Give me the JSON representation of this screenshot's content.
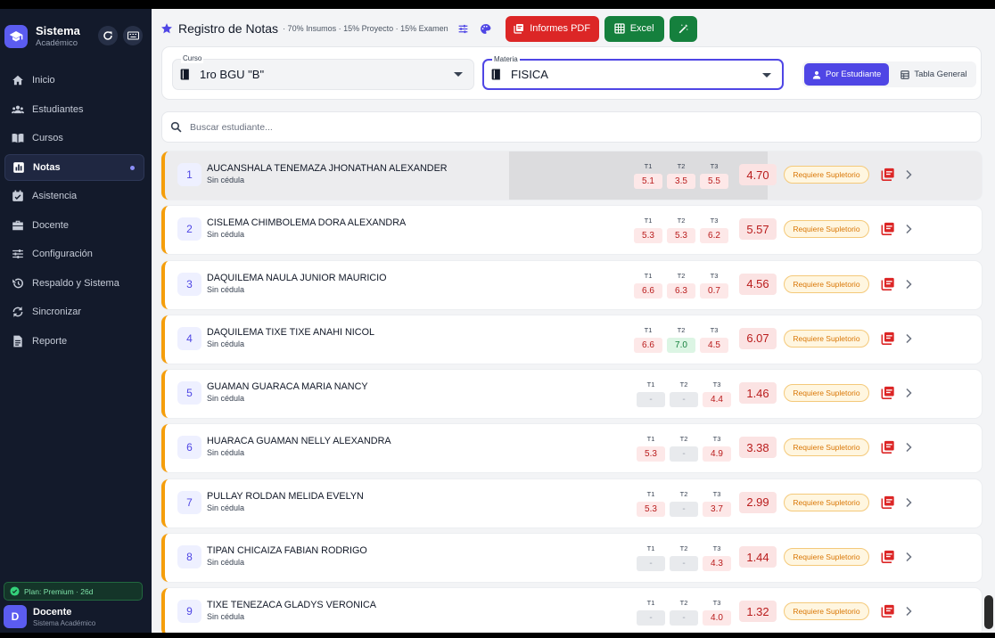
{
  "sidebar": {
    "title": "Sistema",
    "subtitle": "Académico",
    "items": [
      {
        "label": "Inicio",
        "icon": "home-icon"
      },
      {
        "label": "Estudiantes",
        "icon": "users-icon"
      },
      {
        "label": "Cursos",
        "icon": "book-open-icon"
      },
      {
        "label": "Notas",
        "icon": "chart-icon",
        "active": true
      },
      {
        "label": "Asistencia",
        "icon": "calendar-check-icon"
      },
      {
        "label": "Docente",
        "icon": "briefcase-icon"
      },
      {
        "label": "Configuración",
        "icon": "sliders-icon"
      },
      {
        "label": "Respaldo y Sistema",
        "icon": "history-icon"
      },
      {
        "label": "Sincronizar",
        "icon": "sync-icon"
      },
      {
        "label": "Reporte",
        "icon": "document-icon"
      }
    ],
    "plan": "Plan: Premium · 26d",
    "user": {
      "initial": "D",
      "name": "Docente",
      "role": "Sistema Académico"
    }
  },
  "header": {
    "title": "Registro de Notas",
    "subtitle": "· 70% Insumos · 15% Proyecto · 15% Examen",
    "pdf_label": "Informes PDF",
    "excel_label": "Excel"
  },
  "filters": {
    "curso_label": "Curso",
    "curso_value": "1ro BGU \"B\"",
    "materia_label": "Materia",
    "materia_value": "FISICA",
    "view_student": "Por Estudiante",
    "view_table": "Tabla General"
  },
  "search": {
    "placeholder": "Buscar estudiante..."
  },
  "term_labels": [
    "T1",
    "T2",
    "T3"
  ],
  "students": [
    {
      "n": "1",
      "name": "AUCANSHALA TENEMAZA JHONATHAN ALEXANDER",
      "ced": "Sin cédula",
      "t": [
        "5.1",
        "3.5",
        "5.5"
      ],
      "avg": "4.70",
      "status": "Requiere Supletorio"
    },
    {
      "n": "2",
      "name": "CISLEMA CHIMBOLEMA DORA ALEXANDRA",
      "ced": "Sin cédula",
      "t": [
        "5.3",
        "5.3",
        "6.2"
      ],
      "avg": "5.57",
      "status": "Requiere Supletorio"
    },
    {
      "n": "3",
      "name": "DAQUILEMA NAULA JUNIOR MAURICIO",
      "ced": "Sin cédula",
      "t": [
        "6.6",
        "6.3",
        "0.7"
      ],
      "avg": "4.56",
      "status": "Requiere Supletorio"
    },
    {
      "n": "4",
      "name": "DAQUILEMA TIXE TIXE ANAHI NICOL",
      "ced": "Sin cédula",
      "t": [
        "6.6",
        "7.0",
        "4.5"
      ],
      "avg": "6.07",
      "status": "Requiere Supletorio"
    },
    {
      "n": "5",
      "name": "GUAMAN GUARACA MARIA NANCY",
      "ced": "Sin cédula",
      "t": [
        "-",
        "-",
        "4.4"
      ],
      "avg": "1.46",
      "status": "Requiere Supletorio"
    },
    {
      "n": "6",
      "name": "HUARACA GUAMAN NELLY ALEXANDRA",
      "ced": "Sin cédula",
      "t": [
        "5.3",
        "-",
        "4.9"
      ],
      "avg": "3.38",
      "status": "Requiere Supletorio"
    },
    {
      "n": "7",
      "name": "PULLAY ROLDAN MELIDA EVELYN",
      "ced": "Sin cédula",
      "t": [
        "5.3",
        "-",
        "3.7"
      ],
      "avg": "2.99",
      "status": "Requiere Supletorio"
    },
    {
      "n": "8",
      "name": "TIPAN CHICAIZA FABIAN RODRIGO",
      "ced": "Sin cédula",
      "t": [
        "-",
        "-",
        "4.3"
      ],
      "avg": "1.44",
      "status": "Requiere Supletorio"
    },
    {
      "n": "9",
      "name": "TIXE TENEZACA  GLADYS VERONICA",
      "ced": "Sin cédula",
      "t": [
        "-",
        "-",
        "4.0"
      ],
      "avg": "1.32",
      "status": "Requiere Supletorio"
    }
  ],
  "colors": {
    "accent": "#4f46e5",
    "sidebar": "#131a2b",
    "pdf": "#dc2626",
    "excel": "#15803d",
    "warning": "#f59e0b"
  }
}
